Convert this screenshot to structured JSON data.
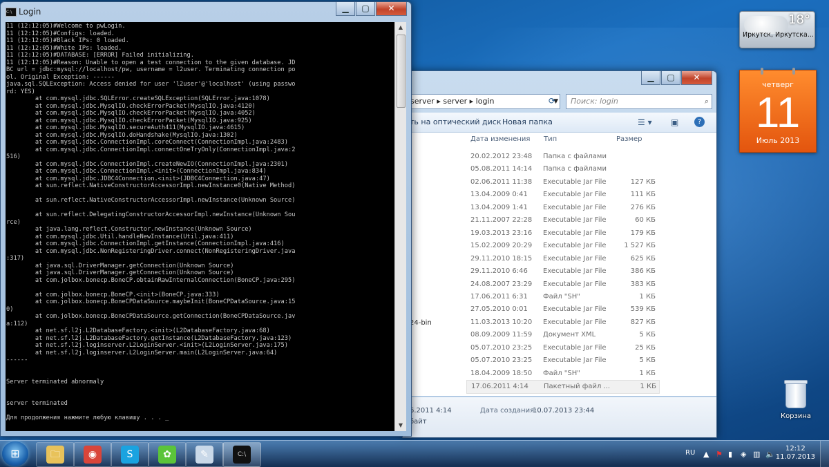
{
  "console": {
    "title": "Login",
    "lines": [
      "11 (12:12:05)#Welcome to pwLogin.",
      "11 (12:12:05)#Configs: loaded.",
      "11 (12:12:05)#Black IPs: 0 loaded.",
      "11 (12:12:05)#White IPs: loaded.",
      "11 (12:12:05)#DATABASE: [ERROR] Failed initializing.",
      "11 (12:12:05)#Reason: Unable to open a test connection to the given database. JD",
      "BC url = jdbc:mysql://localhost/pw, username = l2user. Terminating connection po",
      "ol. Original Exception: ------",
      "java.sql.SQLException: Access denied for user 'l2user'@'localhost' (using passwo",
      "rd: YES)",
      "        at com.mysql.jdbc.SQLError.createSQLException(SQLError.java:1078)",
      "        at com.mysql.jdbc.MysqlIO.checkErrorPacket(MysqlIO.java:4120)",
      "        at com.mysql.jdbc.MysqlIO.checkErrorPacket(MysqlIO.java:4052)",
      "        at com.mysql.jdbc.MysqlIO.checkErrorPacket(MysqlIO.java:925)",
      "        at com.mysql.jdbc.MysqlIO.secureAuth411(MysqlIO.java:4615)",
      "        at com.mysql.jdbc.MysqlIO.doHandshake(MysqlIO.java:1302)",
      "        at com.mysql.jdbc.ConnectionImpl.coreConnect(ConnectionImpl.java:2483)",
      "        at com.mysql.jdbc.ConnectionImpl.connectOneTryOnly(ConnectionImpl.java:2",
      "516)",
      "        at com.mysql.jdbc.ConnectionImpl.createNewIO(ConnectionImpl.java:2301)",
      "        at com.mysql.jdbc.ConnectionImpl.<init>(ConnectionImpl.java:834)",
      "        at com.mysql.jdbc.JDBC4Connection.<init>(JDBC4Connection.java:47)",
      "        at sun.reflect.NativeConstructorAccessorImpl.newInstance0(Native Method)",
      "",
      "        at sun.reflect.NativeConstructorAccessorImpl.newInstance(Unknown Source)",
      "",
      "        at sun.reflect.DelegatingConstructorAccessorImpl.newInstance(Unknown Sou",
      "rce)",
      "        at java.lang.reflect.Constructor.newInstance(Unknown Source)",
      "        at com.mysql.jdbc.Util.handleNewInstance(Util.java:411)",
      "        at com.mysql.jdbc.ConnectionImpl.getInstance(ConnectionImpl.java:416)",
      "        at com.mysql.jdbc.NonRegisteringDriver.connect(NonRegisteringDriver.java",
      ":317)",
      "        at java.sql.DriverManager.getConnection(Unknown Source)",
      "        at java.sql.DriverManager.getConnection(Unknown Source)",
      "        at com.jolbox.bonecp.BoneCP.obtainRawInternalConnection(BoneCP.java:295)",
      "",
      "        at com.jolbox.bonecp.BoneCP.<init>(BoneCP.java:333)",
      "        at com.jolbox.bonecp.BoneCPDataSource.maybeInit(BoneCPDataSource.java:15",
      "0)",
      "        at com.jolbox.bonecp.BoneCPDataSource.getConnection(BoneCPDataSource.jav",
      "a:112)",
      "        at net.sf.l2j.L2DatabaseFactory.<init>(L2DatabaseFactory.java:68)",
      "        at net.sf.l2j.L2DatabaseFactory.getInstance(L2DatabaseFactory.java:123)",
      "        at net.sf.l2j.loginserver.L2LoginServer.<init>(L2LoginServer.java:175)",
      "        at net.sf.l2j.loginserver.L2LoginServer.main(L2LoginServer.java:64)",
      "------",
      "",
      "",
      "Server terminated abnormaly",
      "",
      "",
      "server terminated",
      "",
      "Для продолжения нажмите любую клавишу . . . _"
    ]
  },
  "explorer": {
    "address": "server ▸ server ▸ login",
    "search_placeholder": "Поиск: login",
    "toolbar": {
      "burn": "ть на оптический диск",
      "new_folder": "Новая папка"
    },
    "columns": {
      "date": "Дата изменения",
      "type": "Тип",
      "size": "Размер"
    },
    "rows": [
      {
        "date": "20.02.2012 23:48",
        "type": "Папка с файлами",
        "size": ""
      },
      {
        "date": "05.08.2011 14:14",
        "type": "Папка с файлами",
        "size": ""
      },
      {
        "date": "02.06.2011 11:38",
        "type": "Executable Jar File",
        "size": "127 КБ"
      },
      {
        "date": "13.04.2009 0:41",
        "type": "Executable Jar File",
        "size": "111 КБ"
      },
      {
        "date": "13.04.2009 1:41",
        "type": "Executable Jar File",
        "size": "276 КБ"
      },
      {
        "date": "21.11.2007 22:28",
        "type": "Executable Jar File",
        "size": "60 КБ"
      },
      {
        "date": "19.03.2013 23:16",
        "type": "Executable Jar File",
        "size": "179 КБ"
      },
      {
        "date": "15.02.2009 20:29",
        "type": "Executable Jar File",
        "size": "1 527 КБ"
      },
      {
        "date": "29.11.2010 18:15",
        "type": "Executable Jar File",
        "size": "625 КБ"
      },
      {
        "date": "29.11.2010 6:46",
        "type": "Executable Jar File",
        "size": "386 КБ"
      },
      {
        "date": "24.08.2007 23:29",
        "type": "Executable Jar File",
        "size": "383 КБ"
      },
      {
        "date": "17.06.2011 6:31",
        "type": "Файл \"SH\"",
        "size": "1 КБ"
      },
      {
        "date": "27.05.2010 0:01",
        "type": "Executable Jar File",
        "size": "539 КБ"
      },
      {
        "date": "11.03.2013 10:20",
        "type": "Executable Jar File",
        "size": "827 КБ"
      },
      {
        "date": "08.09.2009 11:59",
        "type": "Документ XML",
        "size": "5 КБ"
      },
      {
        "date": "05.07.2010 23:25",
        "type": "Executable Jar File",
        "size": "25 КБ"
      },
      {
        "date": "05.07.2010 23:25",
        "type": "Executable Jar File",
        "size": "5 КБ"
      },
      {
        "date": "18.04.2009 18:50",
        "type": "Файл \"SH\"",
        "size": "1 КБ"
      },
      {
        "date": "17.06.2011 4:14",
        "type": "Пакетный файл ...",
        "size": "1 КБ"
      }
    ],
    "partial_name": "24-bin",
    "details": {
      "modified": "6.2011 4:14",
      "created_label": "Дата создания:",
      "created_value": "10.07.2013 23:44",
      "size_label": "байт"
    }
  },
  "weather": {
    "temp": "18°",
    "city": "Иркутск, Иркутска..."
  },
  "calendar": {
    "weekday": "четверг",
    "day": "11",
    "month_year": "Июль 2013"
  },
  "recycle_bin": {
    "label": "Корзина"
  },
  "taskbar": {
    "lang": "RU",
    "time": "12:12",
    "date": "11.07.2013",
    "items": [
      {
        "name": "explorer",
        "glyph": "🗀"
      },
      {
        "name": "chrome",
        "glyph": "◉"
      },
      {
        "name": "skype",
        "glyph": "S"
      },
      {
        "name": "app-green",
        "glyph": "✿"
      },
      {
        "name": "app-notes",
        "glyph": "✎"
      },
      {
        "name": "cmd",
        "glyph": "C:\\"
      }
    ]
  }
}
